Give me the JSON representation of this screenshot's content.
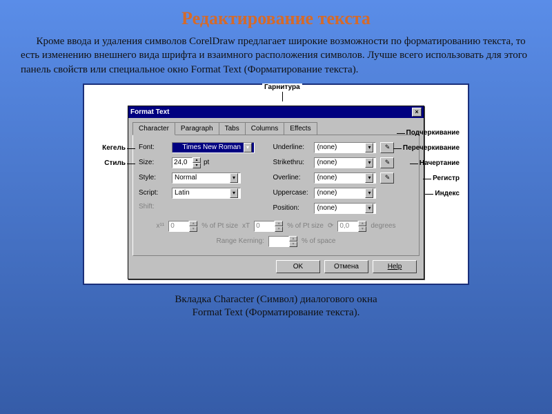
{
  "slide": {
    "title": "Редактирование текста",
    "paragraph": "Кроме ввода и удаления символов CorelDraw  предлагает широкие возможности по форматированию текста, то есть изменению внешнего вида шрифта и взаимного расположения символов. Лучше всего использовать для этого панель свойств или специальное окно Format Text (Форматирование текста).",
    "caption1": "Вкладка Character (Символ) диалогового окна",
    "caption2": "Format Text (Форматирование текста)."
  },
  "callouts": {
    "top": "Гарнитура",
    "left_size": "Кегель",
    "left_style": "Стиль",
    "r_underline": "Подчеркивание",
    "r_strike": "Перечеркивание",
    "r_overline": "Начертание",
    "r_uppercase": "Регистр",
    "r_position": "Индекс"
  },
  "dialog": {
    "title": "Format Text",
    "close": "×",
    "tabs": [
      "Character",
      "Paragraph",
      "Tabs",
      "Columns",
      "Effects"
    ],
    "left": {
      "font_lbl": "Font:",
      "font_val": "Times New Roman",
      "size_lbl": "Size:",
      "size_val": "24,0",
      "size_unit": "pt",
      "style_lbl": "Style:",
      "style_val": "Normal",
      "script_lbl": "Script:",
      "script_val": "Latin",
      "shift_lbl": "Shift:"
    },
    "right": {
      "underline_lbl": "Underline:",
      "underline_val": "(none)",
      "strike_lbl": "Strikethru:",
      "strike_val": "(none)",
      "overline_lbl": "Overline:",
      "overline_val": "(none)",
      "upper_lbl": "Uppercase:",
      "upper_val": "(none)",
      "pos_lbl": "Position:",
      "pos_val": "(none)"
    },
    "bottom": {
      "x_lbl": "x¹¹",
      "x_val": "0",
      "x_unit": "% of Pt size",
      "xt_lbl": "xT",
      "xt_val": "0",
      "xt_unit": "% of Pt size",
      "rot_val": "0,0",
      "rot_unit": "degrees",
      "range_lbl": "Range Kerning:",
      "range_unit": "% of space"
    },
    "buttons": {
      "ok": "OK",
      "cancel": "Отмена",
      "help": "Help"
    }
  }
}
